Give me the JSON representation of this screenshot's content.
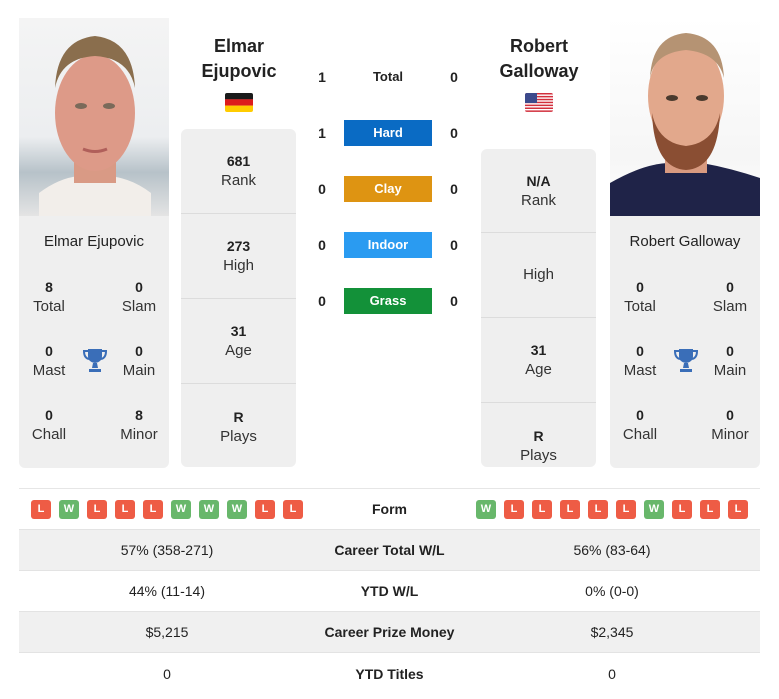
{
  "colors": {
    "hard": "#0a6bc4",
    "clay": "#de9412",
    "indoor": "#2a9bf1",
    "grass": "#139139",
    "win": "#68b76b",
    "loss": "#ee5c45",
    "trophy": "#3a6eb8"
  },
  "player1": {
    "name_line1": "Elmar",
    "name_line2": "Ejupovic",
    "full_name": "Elmar Ejupovic",
    "flag": "germany-flag",
    "rank": "681",
    "rank_label": "Rank",
    "high": "273",
    "high_label": "High",
    "age": "31",
    "age_label": "Age",
    "plays": "R",
    "plays_label": "Plays",
    "titles": {
      "total": "8",
      "total_label": "Total",
      "slam": "0",
      "slam_label": "Slam",
      "mast": "0",
      "mast_label": "Mast",
      "main": "0",
      "main_label": "Main",
      "chall": "0",
      "chall_label": "Chall",
      "minor": "8",
      "minor_label": "Minor"
    },
    "form": [
      "L",
      "W",
      "L",
      "L",
      "L",
      "W",
      "W",
      "W",
      "L",
      "L"
    ]
  },
  "player2": {
    "name_line1": "Robert",
    "name_line2": "Galloway",
    "full_name": "Robert Galloway",
    "flag": "usa-flag",
    "rank": "N/A",
    "rank_label": "Rank",
    "high": "",
    "high_label": "High",
    "age": "31",
    "age_label": "Age",
    "plays": "R",
    "plays_label": "Plays",
    "titles": {
      "total": "0",
      "total_label": "Total",
      "slam": "0",
      "slam_label": "Slam",
      "mast": "0",
      "mast_label": "Mast",
      "main": "0",
      "main_label": "Main",
      "chall": "0",
      "chall_label": "Chall",
      "minor": "0",
      "minor_label": "Minor"
    },
    "form": [
      "W",
      "L",
      "L",
      "L",
      "L",
      "L",
      "W",
      "L",
      "L",
      "L"
    ]
  },
  "h2h": [
    {
      "label": "Total",
      "p1": "1",
      "p2": "0",
      "surface": "total"
    },
    {
      "label": "Hard",
      "p1": "1",
      "p2": "0",
      "surface": "hard"
    },
    {
      "label": "Clay",
      "p1": "0",
      "p2": "0",
      "surface": "clay"
    },
    {
      "label": "Indoor",
      "p1": "0",
      "p2": "0",
      "surface": "indoor"
    },
    {
      "label": "Grass",
      "p1": "0",
      "p2": "0",
      "surface": "grass"
    }
  ],
  "stats": {
    "form_label": "Form",
    "rows": [
      {
        "label": "Career Total W/L",
        "p1": "57% (358-271)",
        "p2": "56% (83-64)"
      },
      {
        "label": "YTD W/L",
        "p1": "44% (11-14)",
        "p2": "0% (0-0)"
      },
      {
        "label": "Career Prize Money",
        "p1": "$5,215",
        "p2": "$2,345"
      },
      {
        "label": "YTD Titles",
        "p1": "0",
        "p2": "0"
      }
    ]
  }
}
